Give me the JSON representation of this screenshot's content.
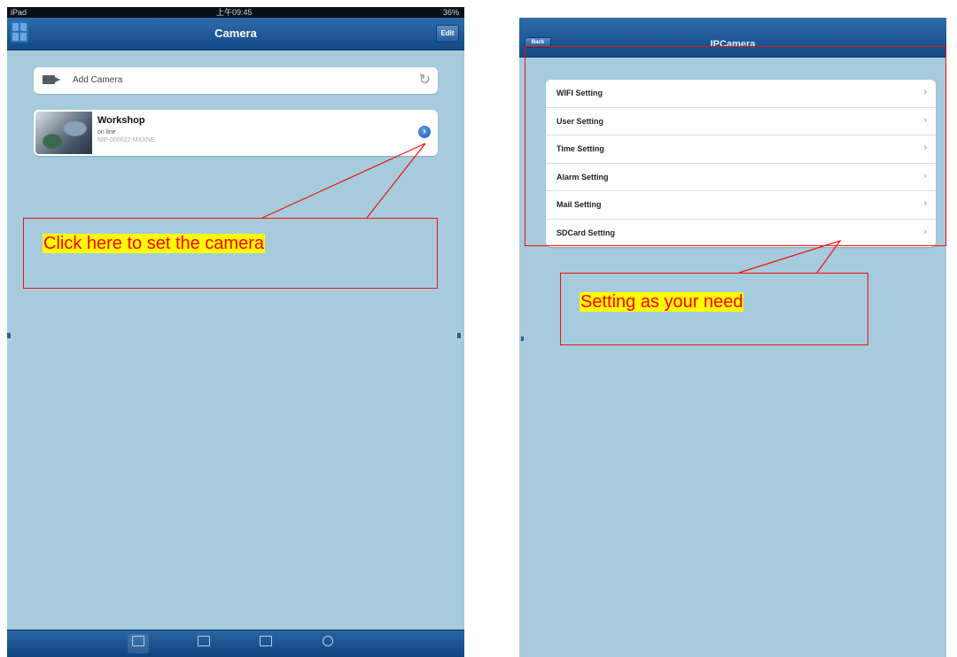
{
  "left_screen": {
    "status_bar": {
      "carrier": "iPad",
      "time": "上午09:45",
      "battery": "36%"
    },
    "nav_title": "Camera",
    "edit_label": "Edit",
    "add_camera_label": "Add Camera",
    "camera": {
      "name": "Workshop",
      "status": "on line",
      "id": "NIP-000022-MXXNE"
    },
    "tab_icons": [
      "camera-tab-icon",
      "photo-tab-icon",
      "video-tab-icon",
      "info-tab-icon"
    ],
    "callout": "Click here to set the camera"
  },
  "right_screen": {
    "nav_title": "IPCamera",
    "back_label": "Back",
    "settings": [
      "WIFI Setting",
      "User Setting",
      "Time Setting",
      "Alarm Setting",
      "Mail Setting",
      "SDCard Setting"
    ],
    "callout": "Setting as your need"
  },
  "colors": {
    "background": "#a6cbdc",
    "nav_bar": "#1d5a98",
    "callout_border": "#ee1111",
    "callout_text": "#ff0000",
    "callout_highlight": "#ffff00"
  }
}
